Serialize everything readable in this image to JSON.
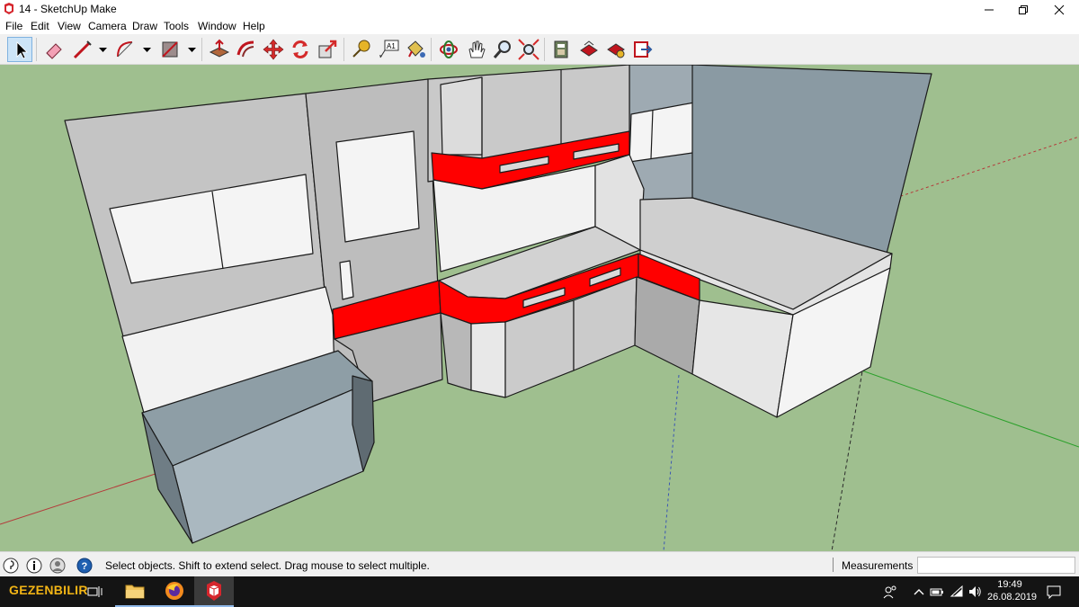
{
  "window": {
    "title": "14 - SketchUp Make",
    "controls": {
      "minimize": "minimize-icon",
      "maximize": "restore-icon",
      "close": "close-icon"
    }
  },
  "menu": [
    "File",
    "Edit",
    "View",
    "Camera",
    "Draw",
    "Tools",
    "Window",
    "Help"
  ],
  "toolbar": {
    "tools": [
      {
        "name": "select-tool-icon",
        "active": true
      },
      {
        "name": "eraser-tool-icon"
      },
      {
        "name": "line-tool-icon",
        "dropdown": true
      },
      {
        "name": "arc-tool-icon",
        "dropdown": true
      },
      {
        "name": "rectangle-tool-icon",
        "dropdown": true
      },
      {
        "name": "push-pull-tool-icon"
      },
      {
        "name": "offset-tool-icon"
      },
      {
        "name": "move-tool-icon"
      },
      {
        "name": "rotate-tool-icon"
      },
      {
        "name": "scale-tool-icon"
      },
      {
        "name": "tape-measure-tool-icon"
      },
      {
        "name": "text-tool-icon"
      },
      {
        "name": "paint-bucket-tool-icon"
      },
      {
        "name": "orbit-tool-icon"
      },
      {
        "name": "pan-tool-icon"
      },
      {
        "name": "zoom-tool-icon"
      },
      {
        "name": "zoom-extents-tool-icon"
      },
      {
        "name": "warehouse-icon"
      },
      {
        "name": "share-model-icon"
      },
      {
        "name": "extension-warehouse-icon"
      },
      {
        "name": "send-to-layout-icon"
      }
    ]
  },
  "viewport": {
    "background_color": "#9fbf8f",
    "accent_color": "#ff0000",
    "wall_color": "#c0c0c0",
    "panel_color": "#f2f2f2",
    "dark_panel_color": "#8a9aa3"
  },
  "status": {
    "icons": [
      "geo-location-icon",
      "credits-icon",
      "user-account-icon",
      "help-icon"
    ],
    "text": "Select objects. Shift to extend select. Drag mouse to select multiple.",
    "measurements_label": "Measurements",
    "measurements_value": ""
  },
  "taskbar": {
    "start_label": "GEZENBILIR",
    "apps": [
      "task-view-icon",
      "file-explorer-icon",
      "firefox-icon",
      "sketchup-icon"
    ],
    "tray": [
      "people-icon",
      "show-hidden-icons-icon",
      "battery-icon",
      "network-icon",
      "volume-icon"
    ],
    "time": "19:49",
    "date": "26.08.2019",
    "notifications": "notifications-icon"
  }
}
